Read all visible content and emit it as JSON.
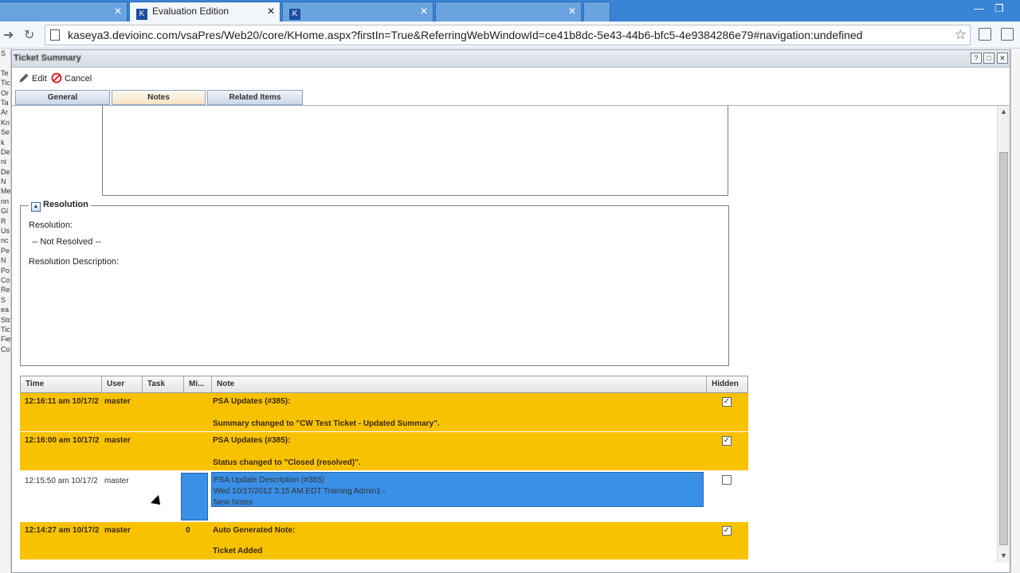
{
  "browser": {
    "tabs": [
      {
        "label": "",
        "active": false
      },
      {
        "label": "Evaluation Edition",
        "active": true
      },
      {
        "label": "",
        "active": false
      },
      {
        "label": "",
        "active": false
      },
      {
        "label": "",
        "active": false
      }
    ],
    "url": "kaseya3.devioinc.com/vsaPres/Web20/core/KHome.aspx?firstIn=True&ReferringWebWindowId=ce41b8dc-5e43-44b6-bfc5-4e9384286e79#navigation:undefined"
  },
  "left_sliver": [
    "S",
    "",
    "Te",
    "Tic",
    "Or",
    "Ta",
    "Ar",
    "Kn",
    "Se",
    "k",
    "De",
    "ni",
    "De",
    "N",
    "Me",
    "nn",
    "Gl",
    "R",
    "Us",
    "nc",
    "Pe",
    "N",
    "Po",
    "Co",
    "Re",
    "S",
    "ea",
    "Sto",
    "Tic",
    "Fie",
    "Co"
  ],
  "dialog": {
    "title": "Ticket Summary",
    "toolbar": {
      "edit_label": "Edit",
      "cancel_label": "Cancel"
    },
    "tabs": [
      {
        "label": "General",
        "active": false
      },
      {
        "label": "Notes",
        "active": true
      },
      {
        "label": "Related Items",
        "active": false
      }
    ],
    "resolution": {
      "legend": "Resolution",
      "resolution_label": "Resolution:",
      "resolution_value": "-- Not Resolved --",
      "description_label": "Resolution Description:"
    },
    "grid": {
      "columns": [
        "Time",
        "User",
        "Task",
        "Mi...",
        "Note",
        "Hidden"
      ],
      "rows": [
        {
          "time": "12:16:11 am 10/17/2",
          "user": "master",
          "task": "",
          "mins": "",
          "note_line1": "PSA Updates (#385):",
          "note_line2": "Summary changed to \"CW Test Ticket - Updated Summary\".",
          "note_line3": "",
          "hidden": true,
          "style": "auto"
        },
        {
          "time": "12:16:00 am 10/17/2",
          "user": "master",
          "task": "",
          "mins": "",
          "note_line1": "PSA Updates (#385):",
          "note_line2": "Status changed to \"Closed (resolved)\".",
          "note_line3": "",
          "hidden": true,
          "style": "auto"
        },
        {
          "time": "12:15:50 am 10/17/2",
          "user": "master",
          "task": "",
          "mins": "",
          "note_line1": "PSA Update Description (#385)",
          "note_line2": "Wed 10/17/2012 3:15 AM EDT Training Admin1 -",
          "note_line3": "New Notes",
          "hidden": false,
          "style": "plain"
        },
        {
          "time": "12:14:27 am 10/17/2",
          "user": "master",
          "task": "",
          "mins": "0",
          "note_line1": "Auto Generated Note:",
          "note_line2": "Ticket Added",
          "note_line3": "",
          "hidden": true,
          "style": "auto"
        }
      ]
    }
  },
  "colors": {
    "auto_row": "#f8c200",
    "selection": "#3a8fe6",
    "chrome": "#3a84d6"
  }
}
